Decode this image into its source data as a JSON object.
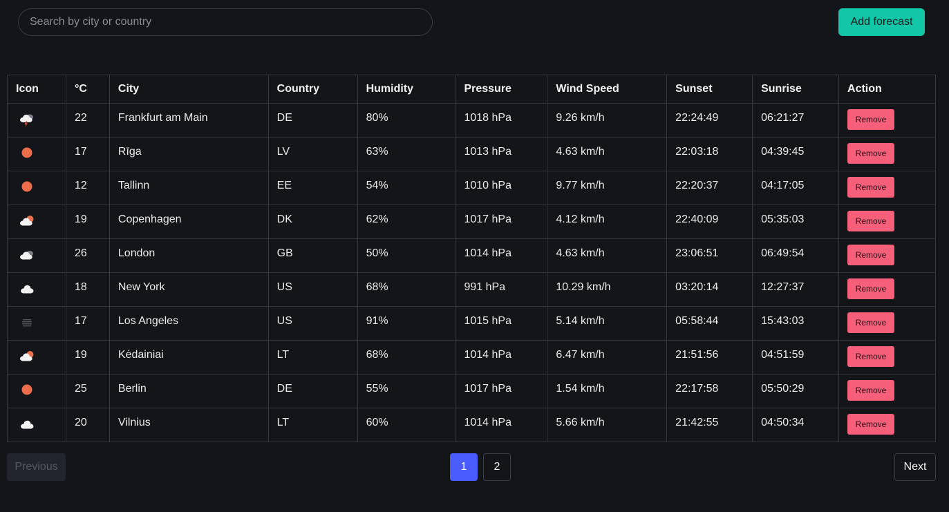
{
  "search": {
    "placeholder": "Search by city or country"
  },
  "toolbar": {
    "add_label": "Add forecast"
  },
  "table": {
    "headers": [
      "Icon",
      "°C",
      "City",
      "Country",
      "Humidity",
      "Pressure",
      "Wind Speed",
      "Sunset",
      "Sunrise",
      "Action"
    ],
    "remove_label": "Remove",
    "rows": [
      {
        "icon": "thunderstorm-icon",
        "temp": "22",
        "city": "Frankfurt am Main",
        "country": "DE",
        "humidity": "80%",
        "pressure": "1018 hPa",
        "wind": "9.26 km/h",
        "sunset": "22:24:49",
        "sunrise": "06:21:27"
      },
      {
        "icon": "sun-icon",
        "temp": "17",
        "city": "Rīga",
        "country": "LV",
        "humidity": "63%",
        "pressure": "1013 hPa",
        "wind": "4.63 km/h",
        "sunset": "22:03:18",
        "sunrise": "04:39:45"
      },
      {
        "icon": "sun-icon",
        "temp": "12",
        "city": "Tallinn",
        "country": "EE",
        "humidity": "54%",
        "pressure": "1010 hPa",
        "wind": "9.77 km/h",
        "sunset": "22:20:37",
        "sunrise": "04:17:05"
      },
      {
        "icon": "partly-cloudy-icon",
        "temp": "19",
        "city": "Copenhagen",
        "country": "DK",
        "humidity": "62%",
        "pressure": "1017 hPa",
        "wind": "4.12 km/h",
        "sunset": "22:40:09",
        "sunrise": "05:35:03"
      },
      {
        "icon": "broken-clouds-icon",
        "temp": "26",
        "city": "London",
        "country": "GB",
        "humidity": "50%",
        "pressure": "1014 hPa",
        "wind": "4.63 km/h",
        "sunset": "23:06:51",
        "sunrise": "06:49:54"
      },
      {
        "icon": "cloud-icon",
        "temp": "18",
        "city": "New York",
        "country": "US",
        "humidity": "68%",
        "pressure": "991 hPa",
        "wind": "10.29 km/h",
        "sunset": "03:20:14",
        "sunrise": "12:27:37"
      },
      {
        "icon": "mist-icon",
        "temp": "17",
        "city": "Los Angeles",
        "country": "US",
        "humidity": "91%",
        "pressure": "1015 hPa",
        "wind": "5.14 km/h",
        "sunset": "05:58:44",
        "sunrise": "15:43:03"
      },
      {
        "icon": "partly-cloudy-icon",
        "temp": "19",
        "city": "Kėdainiai",
        "country": "LT",
        "humidity": "68%",
        "pressure": "1014 hPa",
        "wind": "6.47 km/h",
        "sunset": "21:51:56",
        "sunrise": "04:51:59"
      },
      {
        "icon": "sun-icon",
        "temp": "25",
        "city": "Berlin",
        "country": "DE",
        "humidity": "55%",
        "pressure": "1017 hPa",
        "wind": "1.54 km/h",
        "sunset": "22:17:58",
        "sunrise": "05:50:29"
      },
      {
        "icon": "cloud-icon",
        "temp": "20",
        "city": "Vilnius",
        "country": "LT",
        "humidity": "60%",
        "pressure": "1014 hPa",
        "wind": "5.66 km/h",
        "sunset": "21:42:55",
        "sunrise": "04:50:34"
      }
    ]
  },
  "pagination": {
    "previous_label": "Previous",
    "next_label": "Next",
    "pages": [
      "1",
      "2"
    ],
    "current_page": "1"
  },
  "colors": {
    "background": "#141519",
    "accent": "#12c7a8",
    "danger": "#f55f79",
    "page_active": "#4a5cff",
    "sun": "#ec6e4c"
  }
}
